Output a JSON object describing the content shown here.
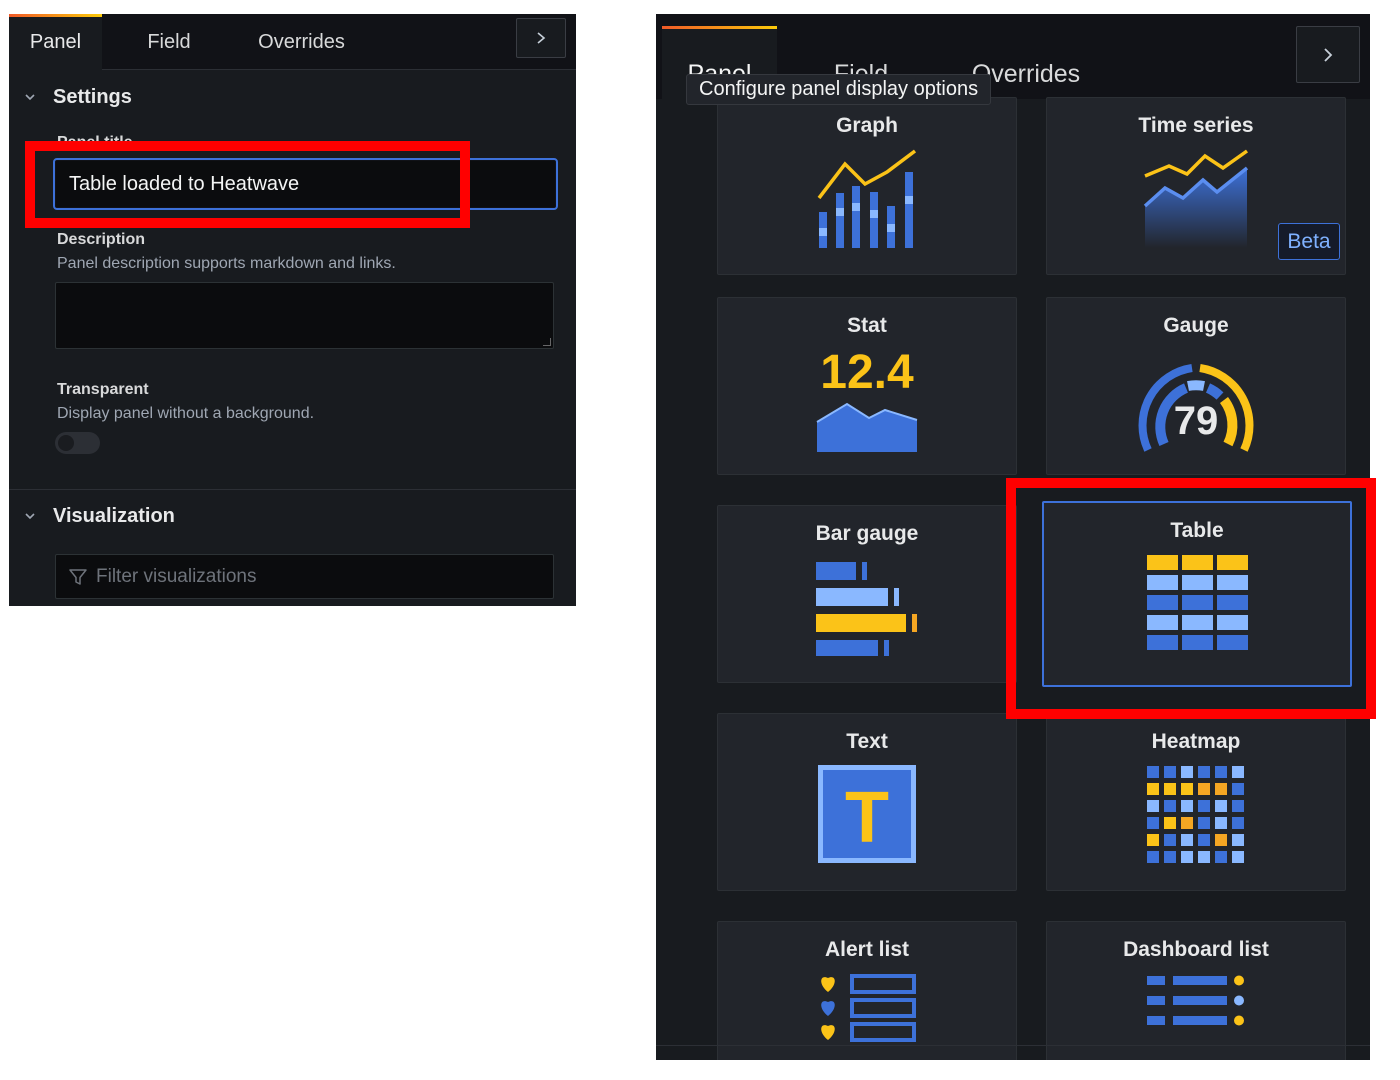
{
  "left_editor": {
    "tabs": {
      "panel": "Panel",
      "field": "Field",
      "overrides": "Overrides"
    },
    "settings": {
      "heading": "Settings",
      "panel_title_label": "Panel title",
      "panel_title_value": "Table loaded to Heatwave",
      "description_label": "Description",
      "description_help": "Panel description supports markdown and links.",
      "description_value": "",
      "transparent_label": "Transparent",
      "transparent_help": "Display panel without a background.",
      "transparent_on": false
    },
    "visualization": {
      "heading": "Visualization",
      "filter_placeholder": "Filter visualizations"
    }
  },
  "right_editor": {
    "tabs": {
      "panel": "Panel",
      "field": "Field",
      "overrides": "Overrides"
    },
    "tooltip": "Configure panel display options",
    "visualizations": [
      {
        "name": "Graph"
      },
      {
        "name": "Time series",
        "badge": "Beta"
      },
      {
        "name": "Stat",
        "value": "12.4"
      },
      {
        "name": "Gauge",
        "value": "79"
      },
      {
        "name": "Bar gauge"
      },
      {
        "name": "Table",
        "selected": true
      },
      {
        "name": "Text",
        "glyph": "T"
      },
      {
        "name": "Heatmap"
      },
      {
        "name": "Alert list"
      },
      {
        "name": "Dashboard list"
      }
    ]
  },
  "colors": {
    "accent_blue": "#3d71d9",
    "light_blue": "#8ab8ff",
    "yellow": "#fbc318",
    "orange": "#f5a623",
    "highlight_red": "#ff0000",
    "panel_bg": "#181b1f",
    "card_bg": "#22252b"
  }
}
